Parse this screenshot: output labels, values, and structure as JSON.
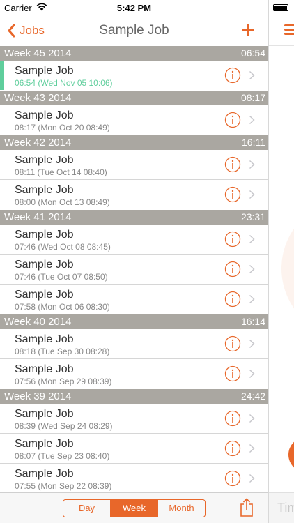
{
  "status_bar": {
    "carrier": "Carrier",
    "time": "5:42 PM"
  },
  "nav": {
    "back_label": "Jobs",
    "title": "Sample Job"
  },
  "colors": {
    "accent": "#e8672a",
    "active_green": "#5fce9c",
    "header_gray": "#aaa7a1"
  },
  "weeks": [
    {
      "label": "Week 45 2014",
      "total": "06:54",
      "rows": [
        {
          "job": "Sample Job",
          "detail": "06:54 (Wed Nov 05 10:06)",
          "active": true
        }
      ]
    },
    {
      "label": "Week 43 2014",
      "total": "08:17",
      "rows": [
        {
          "job": "Sample Job",
          "detail": "08:17 (Mon Oct 20 08:49)"
        }
      ]
    },
    {
      "label": "Week 42 2014",
      "total": "16:11",
      "rows": [
        {
          "job": "Sample Job",
          "detail": "08:11 (Tue Oct 14 08:40)"
        },
        {
          "job": "Sample Job",
          "detail": "08:00 (Mon Oct 13 08:49)"
        }
      ]
    },
    {
      "label": "Week 41 2014",
      "total": "23:31",
      "rows": [
        {
          "job": "Sample Job",
          "detail": "07:46 (Wed Oct 08 08:45)"
        },
        {
          "job": "Sample Job",
          "detail": "07:46 (Tue Oct 07 08:50)"
        },
        {
          "job": "Sample Job",
          "detail": "07:58 (Mon Oct 06 08:30)"
        }
      ]
    },
    {
      "label": "Week 40 2014",
      "total": "16:14",
      "rows": [
        {
          "job": "Sample Job",
          "detail": "08:18 (Tue Sep 30 08:28)"
        },
        {
          "job": "Sample Job",
          "detail": "07:56 (Mon Sep 29 08:39)"
        }
      ]
    },
    {
      "label": "Week 39 2014",
      "total": "24:42",
      "rows": [
        {
          "job": "Sample Job",
          "detail": "08:39 (Wed Sep 24 08:29)"
        },
        {
          "job": "Sample Job",
          "detail": "08:07 (Tue Sep 23 08:40)"
        },
        {
          "job": "Sample Job",
          "detail": "07:55 (Mon Sep 22 08:39)"
        }
      ]
    }
  ],
  "toolbar": {
    "segments": [
      {
        "label": "Day",
        "selected": false
      },
      {
        "label": "Week",
        "selected": true
      },
      {
        "label": "Month",
        "selected": false
      }
    ]
  },
  "side_panel": {
    "field_partial": "Tim"
  },
  "icons": {
    "back": "chevron-left-icon",
    "add": "plus-icon",
    "info": "info-circle-icon",
    "disclosure": "chevron-right-icon",
    "share": "share-icon",
    "menu": "hamburger-menu-icon"
  }
}
